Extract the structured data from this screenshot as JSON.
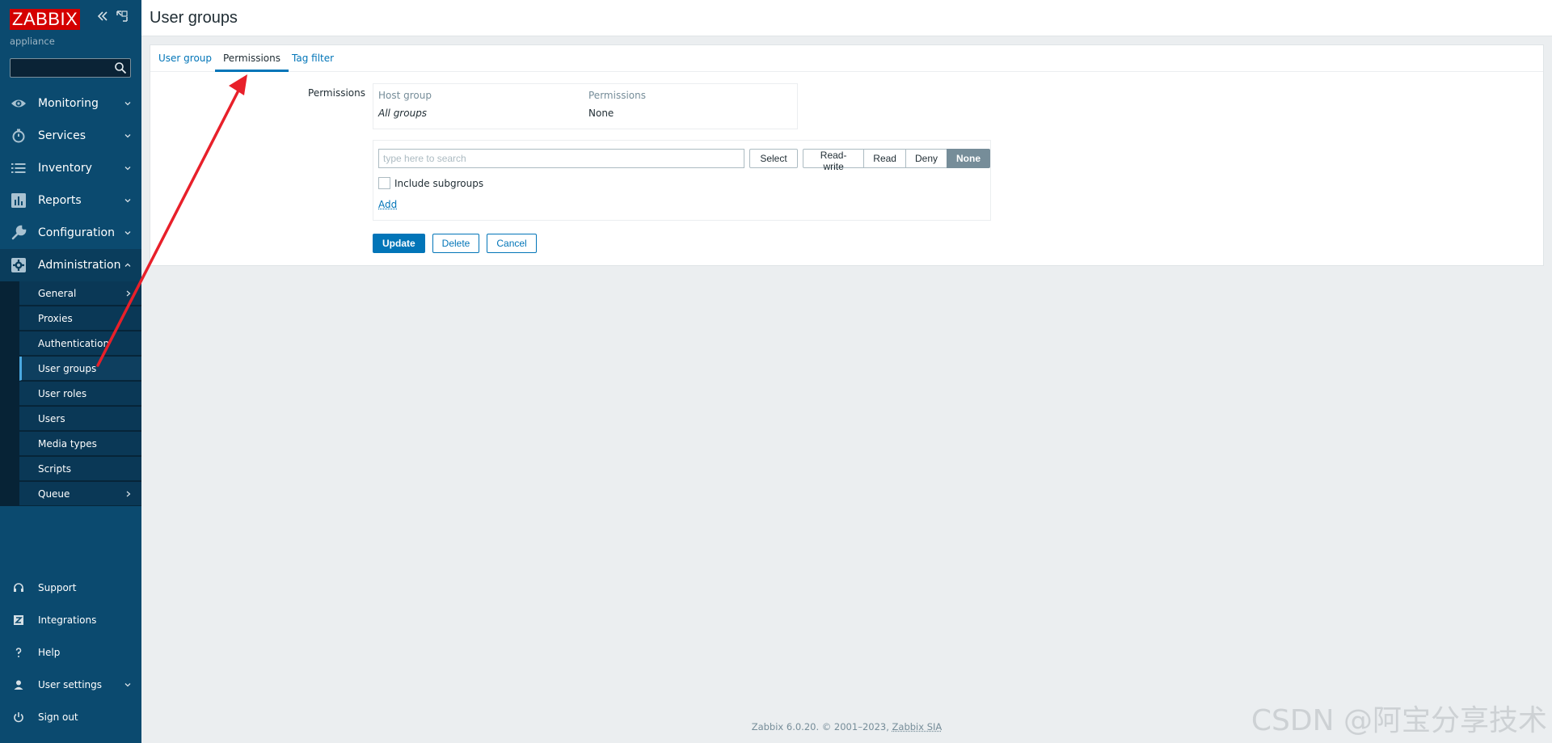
{
  "app": {
    "logo": "ZABBIX",
    "subtitle": "appliance"
  },
  "sidebar": {
    "menu": [
      {
        "label": "Monitoring",
        "icon": "eye-icon"
      },
      {
        "label": "Services",
        "icon": "stopwatch-icon"
      },
      {
        "label": "Inventory",
        "icon": "list-icon"
      },
      {
        "label": "Reports",
        "icon": "bar-chart-icon"
      },
      {
        "label": "Configuration",
        "icon": "wrench-icon"
      },
      {
        "label": "Administration",
        "icon": "gear-icon"
      }
    ],
    "submenu": [
      {
        "label": "General"
      },
      {
        "label": "Proxies"
      },
      {
        "label": "Authentication"
      },
      {
        "label": "User groups"
      },
      {
        "label": "User roles"
      },
      {
        "label": "Users"
      },
      {
        "label": "Media types"
      },
      {
        "label": "Scripts"
      },
      {
        "label": "Queue"
      }
    ],
    "bottom": [
      {
        "label": "Support",
        "icon": "headset-icon"
      },
      {
        "label": "Integrations",
        "icon": "zabbix-z-icon"
      },
      {
        "label": "Help",
        "icon": "question-icon"
      },
      {
        "label": "User settings",
        "icon": "user-icon"
      },
      {
        "label": "Sign out",
        "icon": "power-icon"
      }
    ]
  },
  "header": {
    "title": "User groups"
  },
  "tabs": [
    {
      "label": "User group"
    },
    {
      "label": "Permissions"
    },
    {
      "label": "Tag filter"
    }
  ],
  "form": {
    "permissions_label": "Permissions",
    "table": {
      "headers": [
        "Host group",
        "Permissions"
      ],
      "rows": [
        [
          "All groups",
          "None"
        ]
      ]
    },
    "search_placeholder": "type here to search",
    "select_label": "Select",
    "segments": [
      "Read-write",
      "Read",
      "Deny",
      "None"
    ],
    "selected_segment": "None",
    "include_subgroups_label": "Include subgroups",
    "include_subgroups_checked": false,
    "add_label": "Add",
    "buttons": {
      "update": "Update",
      "delete": "Delete",
      "cancel": "Cancel"
    }
  },
  "footer": {
    "text": "Zabbix 6.0.20. © 2001–2023, ",
    "link": "Zabbix SIA"
  },
  "watermark": "CSDN @阿宝分享技术",
  "colors": {
    "sidebar_bg": "#0b4a6f",
    "logo_red": "#d40000",
    "accent_blue": "#0275b8",
    "annotation_arrow": "#e8202a"
  }
}
